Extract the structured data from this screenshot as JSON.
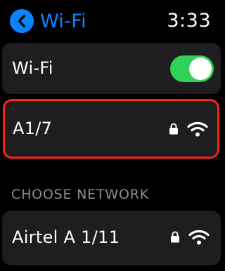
{
  "header": {
    "title": "Wi-Fi",
    "time": "3:33",
    "back_icon": "chevron-left-icon"
  },
  "wifi_toggle": {
    "label": "Wi-Fi",
    "state": "on",
    "on_color": "#30d158"
  },
  "connected_network": {
    "name": "A1/7",
    "secured": true,
    "highlight_color": "#ff1f1f"
  },
  "choose_network": {
    "heading": "CHOOSE NETWORK",
    "networks": [
      {
        "name": "Airtel A 1/11",
        "secured": true
      }
    ]
  },
  "colors": {
    "accent": "#0a84ff",
    "background": "#000000",
    "card": "#1e1e20",
    "secondary_text": "#8e8e93"
  }
}
